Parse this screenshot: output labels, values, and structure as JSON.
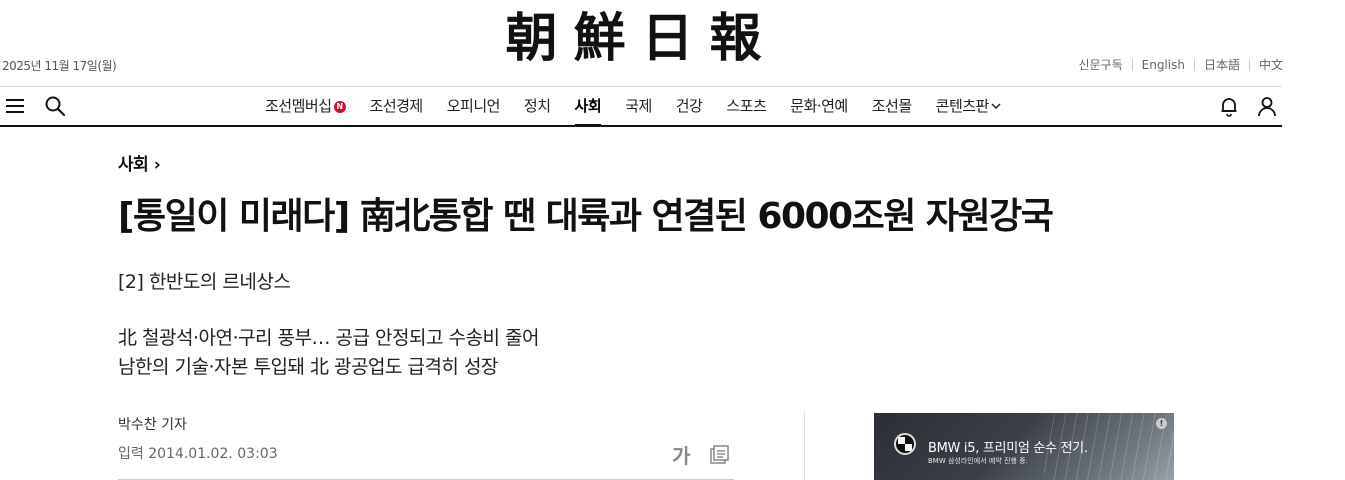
{
  "masthead": {
    "logo": "朝鮮日報",
    "date": "2025년 11월 17일(월)",
    "languages": [
      "신문구독",
      "English",
      "日本語",
      "中文"
    ]
  },
  "nav": {
    "items": [
      {
        "label": "조선멤버십",
        "badge": "N"
      },
      {
        "label": "조선경제"
      },
      {
        "label": "오피니언"
      },
      {
        "label": "정치"
      },
      {
        "label": "사회",
        "active": true
      },
      {
        "label": "국제"
      },
      {
        "label": "건강"
      },
      {
        "label": "스포츠"
      },
      {
        "label": "문화·연예"
      },
      {
        "label": "조선몰"
      },
      {
        "label": "콘텐츠판",
        "dropdown": true
      }
    ]
  },
  "article": {
    "section": "사회",
    "section_chevron": "›",
    "headline": "[통일이 미래다] 南北통합 땐 대륙과 연결된 6000조원 자원강국",
    "subhead": "[2] 한반도의 르네상스",
    "summary": [
      "北 철광석·아연·구리 풍부… 공급 안정되고 수송비 줄어",
      "남한의 기술·자본 투입돼 北 광공업도 급격히 성장"
    ],
    "byline": "박수찬 기자",
    "date": "입력 2014.01.02. 03:03",
    "font_size_label": "가"
  },
  "ad": {
    "title": "BMW i5, 프리미엄 순수 전기.",
    "subtitle": "BMW 삼성라인에서 예약 진행 중.",
    "info": "!"
  },
  "icons": {
    "menu": "hamburger-icon",
    "search": "search-icon",
    "bell": "bell-icon",
    "user": "user-icon",
    "print": "print-icon"
  }
}
